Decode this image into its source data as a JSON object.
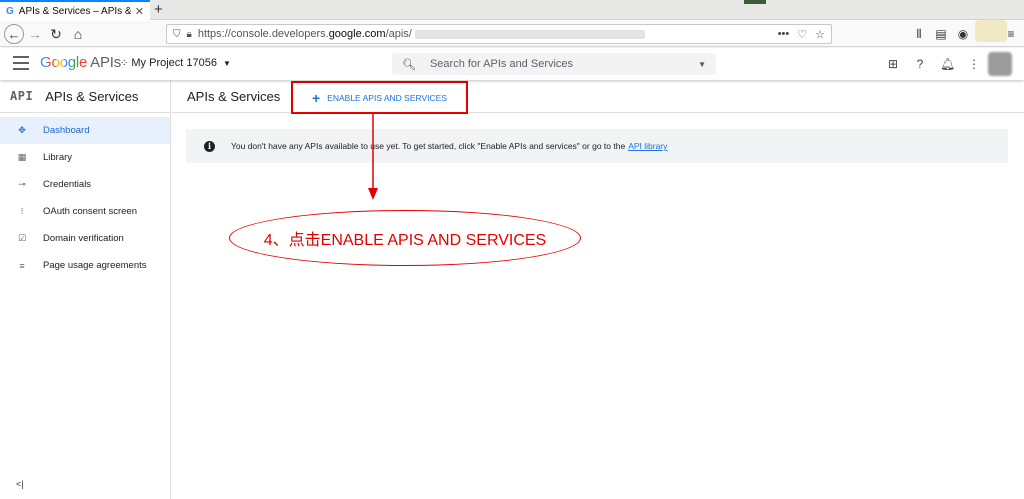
{
  "browser": {
    "tab_title": "APIs & Services – APIs & S",
    "url_prefix": "https://console.developers.",
    "url_domain": "google.com",
    "url_path": "/apis/"
  },
  "header": {
    "logo_google": "Google",
    "logo_apis": "APIs",
    "project_name": "My Project 17056",
    "search_placeholder": "Search for APIs and Services"
  },
  "sidebar": {
    "mark": "API",
    "title": "APIs & Services",
    "items": [
      {
        "label": "Dashboard",
        "icon": "dashboard-icon",
        "active": true
      },
      {
        "label": "Library",
        "icon": "library-icon"
      },
      {
        "label": "Credentials",
        "icon": "key-icon"
      },
      {
        "label": "OAuth consent screen",
        "icon": "consent-icon"
      },
      {
        "label": "Domain verification",
        "icon": "checkbox-icon"
      },
      {
        "label": "Page usage agreements",
        "icon": "settings-list-icon"
      }
    ]
  },
  "main": {
    "page_title": "APIs & Services",
    "enable_button": "ENABLE APIS AND SERVICES",
    "banner_text": "You don't have any APIs available to use yet. To get started, click \"Enable APIs and services\" or go to the",
    "banner_link": "API library"
  },
  "annotation": {
    "callout_text": "4、点击ENABLE APIS AND SERVICES",
    "color": "#e50000"
  },
  "colors": {
    "accent": "#1a73e8",
    "active_bg": "#e8f0fe",
    "annotation": "#e50000"
  }
}
